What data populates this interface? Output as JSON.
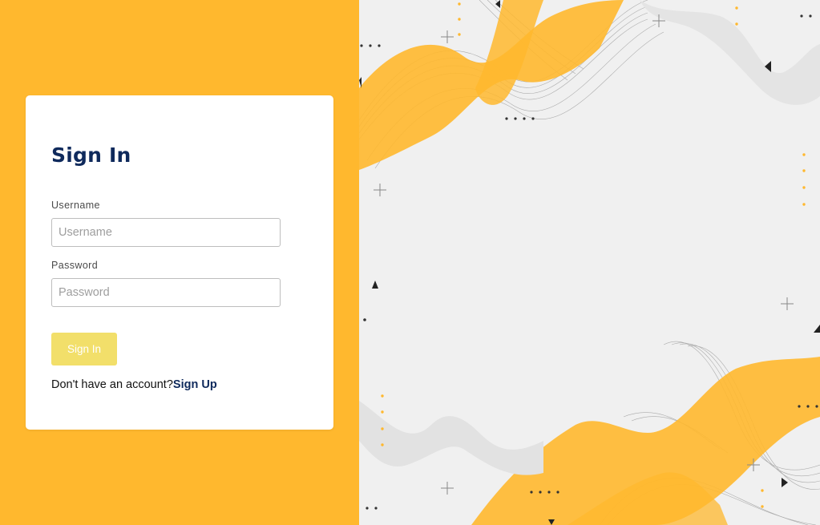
{
  "form": {
    "title": "Sign In",
    "username_label": "Username",
    "username_placeholder": "Username",
    "password_label": "Password",
    "password_placeholder": "Password",
    "submit_label": "Sign In",
    "signup_prompt": "Don't have an account?",
    "signup_link": "Sign Up"
  },
  "colors": {
    "background_accent": "#FFB82E",
    "title": "#0F2A5C",
    "button": "#F2DF6A",
    "decor_background": "#F0F0F0"
  }
}
